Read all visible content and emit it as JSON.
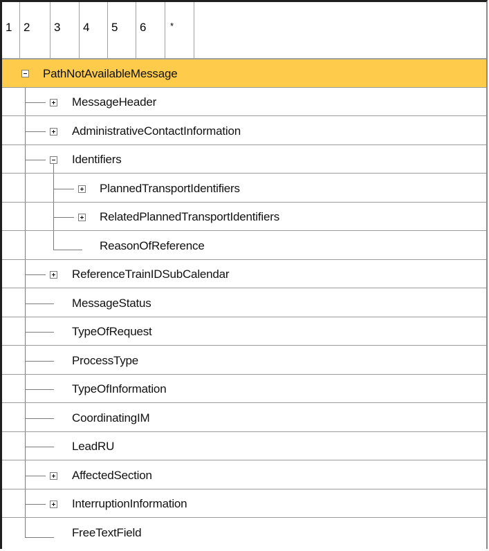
{
  "header": {
    "levels": [
      "1",
      "2",
      "3",
      "4",
      "5",
      "6",
      "*"
    ]
  },
  "tree": {
    "selected": "PathNotAvailableMessage",
    "items": [
      {
        "label": "PathNotAvailableMessage",
        "depth": 0,
        "state": "expanded",
        "selected": true
      },
      {
        "label": "MessageHeader",
        "depth": 1,
        "state": "collapsed"
      },
      {
        "label": "AdministrativeContactInformation",
        "depth": 1,
        "state": "collapsed"
      },
      {
        "label": "Identifiers",
        "depth": 1,
        "state": "expanded"
      },
      {
        "label": "PlannedTransportIdentifiers",
        "depth": 2,
        "state": "collapsed"
      },
      {
        "label": "RelatedPlannedTransportIdentifiers",
        "depth": 2,
        "state": "collapsed"
      },
      {
        "label": "ReasonOfReference",
        "depth": 2,
        "state": "leaf"
      },
      {
        "label": "ReferenceTrainIDSubCalendar",
        "depth": 1,
        "state": "collapsed"
      },
      {
        "label": "MessageStatus",
        "depth": 1,
        "state": "leaf"
      },
      {
        "label": "TypeOfRequest",
        "depth": 1,
        "state": "leaf"
      },
      {
        "label": "ProcessType",
        "depth": 1,
        "state": "leaf"
      },
      {
        "label": "TypeOfInformation",
        "depth": 1,
        "state": "leaf"
      },
      {
        "label": "CoordinatingIM",
        "depth": 1,
        "state": "leaf"
      },
      {
        "label": "LeadRU",
        "depth": 1,
        "state": "leaf"
      },
      {
        "label": "AffectedSection",
        "depth": 1,
        "state": "collapsed"
      },
      {
        "label": "InterruptionInformation",
        "depth": 1,
        "state": "collapsed"
      },
      {
        "label": "FreeTextField",
        "depth": 1,
        "state": "leaf"
      }
    ]
  },
  "colors": {
    "selected_row": "#ffcb4a",
    "grid_line": "#9a9a9a",
    "tree_line": "#7b7b7b"
  }
}
